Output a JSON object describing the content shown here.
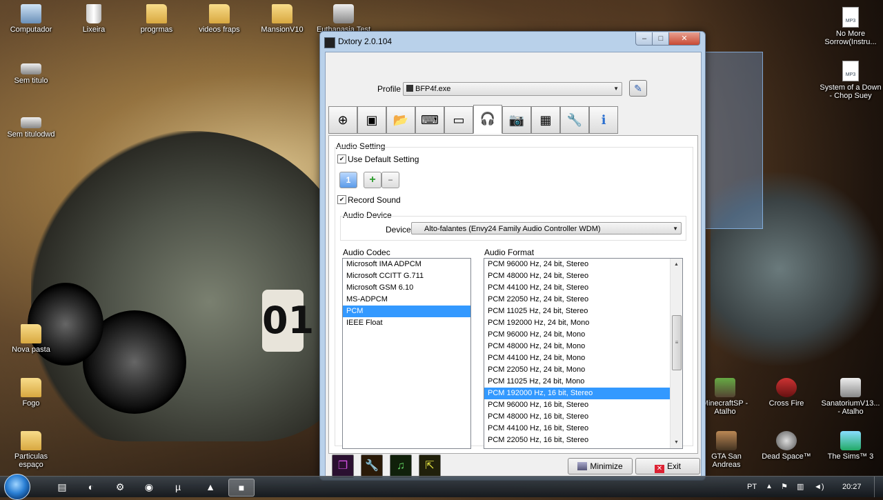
{
  "desktop": {
    "icons_left_top": [
      {
        "label": "Computador",
        "icon": "computer-icon"
      },
      {
        "label": "Lixeira",
        "icon": "recycle-bin-icon"
      },
      {
        "label": "progrmas",
        "icon": "folder-icon"
      },
      {
        "label": "videos fraps",
        "icon": "folder-icon"
      },
      {
        "label": "MansionV10",
        "icon": "folder-icon"
      },
      {
        "label": "Euthanasia Test",
        "icon": "app-icon"
      }
    ],
    "icons_left_col": [
      {
        "label": "Sem titulo",
        "icon": "shortcut-icon"
      },
      {
        "label": "Sem titulodwd",
        "icon": "shortcut-icon"
      },
      {
        "label": "Nova pasta",
        "icon": "folder-icon"
      },
      {
        "label": "Fogo",
        "icon": "folder-icon"
      },
      {
        "label": "Particulas espaço",
        "icon": "folder-icon"
      }
    ],
    "icons_right": [
      {
        "label": "No More Sorrow(Instru...",
        "icon": "mp3-icon"
      },
      {
        "label": "System of a Down - Chop Suey",
        "icon": "mp3-icon"
      },
      {
        "label": "MinecraftSP - Atalho",
        "icon": "minecraft-icon"
      },
      {
        "label": "Cross Fire",
        "icon": "crossfire-icon"
      },
      {
        "label": "SanatoriumV13... - Atalho",
        "icon": "app-icon"
      },
      {
        "label": "GTA San Andreas",
        "icon": "game-icon"
      },
      {
        "label": "Dead Space™",
        "icon": "game-icon"
      },
      {
        "label": "The Sims™ 3",
        "icon": "sims-icon"
      }
    ]
  },
  "window": {
    "title": "Dxtory 2.0.104",
    "controls": {
      "minimize": "–",
      "maximize": "□",
      "close": "✕"
    },
    "profile_label": "Profile",
    "profile_value": "BFP4f.exe",
    "tabs": [
      {
        "name": "target",
        "glyph": "⊕"
      },
      {
        "name": "screen",
        "glyph": "▣"
      },
      {
        "name": "folder",
        "glyph": "📂"
      },
      {
        "name": "keyboard",
        "glyph": "⌨"
      },
      {
        "name": "video",
        "glyph": "▭"
      },
      {
        "name": "audio",
        "glyph": "🎧"
      },
      {
        "name": "screenshot",
        "glyph": "📷"
      },
      {
        "name": "chip",
        "glyph": "▦"
      },
      {
        "name": "tools",
        "glyph": "🔧"
      },
      {
        "name": "info",
        "glyph": "ℹ"
      }
    ],
    "audio": {
      "section_title": "Audio Setting",
      "use_default_label": "Use Default Setting",
      "use_default_checked": true,
      "stream_badge": "1",
      "add_symbol": "+",
      "remove_symbol": "−",
      "record_sound_label": "Record Sound",
      "record_sound_checked": true,
      "device_group_title": "Audio Device",
      "device_label": "Device",
      "device_value": "Alto-falantes (Envy24 Family Audio Controller WDM)",
      "codec_title": "Audio Codec",
      "codecs": [
        "Microsoft IMA ADPCM",
        "Microsoft CCITT G.711",
        "Microsoft GSM 6.10",
        "MS-ADPCM",
        "PCM",
        "IEEE Float"
      ],
      "codec_selected": 4,
      "format_title": "Audio Format",
      "formats": [
        "PCM 96000 Hz, 24 bit, Stereo",
        "PCM 48000 Hz, 24 bit, Stereo",
        "PCM 44100 Hz, 24 bit, Stereo",
        "PCM 22050 Hz, 24 bit, Stereo",
        "PCM 11025 Hz, 24 bit, Stereo",
        "PCM 192000 Hz, 24 bit, Mono",
        "PCM 96000 Hz, 24 bit, Mono",
        "PCM 48000 Hz, 24 bit, Mono",
        "PCM 44100 Hz, 24 bit, Mono",
        "PCM 22050 Hz, 24 bit, Mono",
        "PCM 11025 Hz, 24 bit, Mono",
        "PCM 192000 Hz, 16 bit, Stereo",
        "PCM 96000 Hz, 16 bit, Stereo",
        "PCM 48000 Hz, 16 bit, Stereo",
        "PCM 44100 Hz, 16 bit, Stereo",
        "PCM 22050 Hz, 16 bit, Stereo"
      ],
      "format_selected": 11
    },
    "minimize_label": "Minimize",
    "exit_label": "Exit"
  },
  "taskbar": {
    "language": "PT",
    "clock": "20:27"
  },
  "colors": {
    "selection": "#3399ff",
    "window_frame": "#b9d1ea"
  }
}
